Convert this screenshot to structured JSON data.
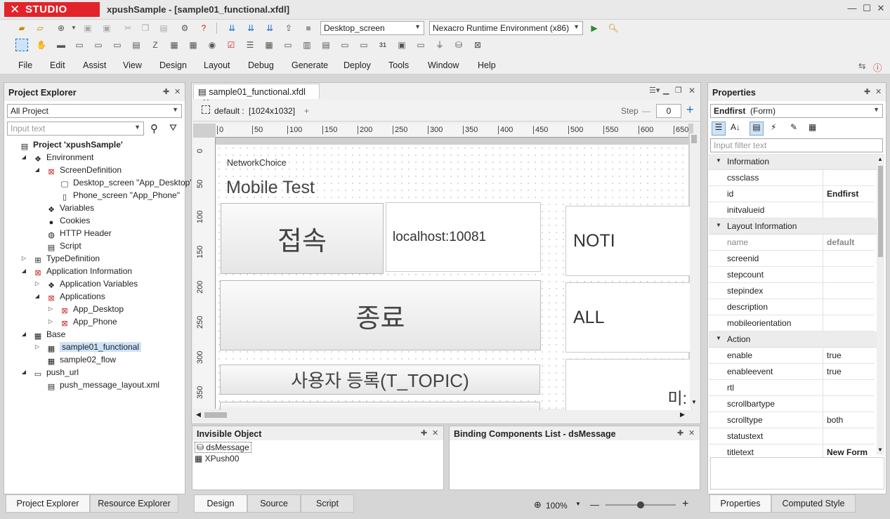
{
  "app": {
    "brand": "STUDIO",
    "window_title": "xpushSample - [sample01_functional.xfdl]"
  },
  "toolbar": {
    "screen_combo": "Desktop_screen",
    "runtime_combo": "Nexacro Runtime Environment (x86)"
  },
  "menu": [
    "File",
    "Edit",
    "Assist",
    "View",
    "Design",
    "Layout",
    "Debug",
    "Generate",
    "Deploy",
    "Tools",
    "Window",
    "Help"
  ],
  "project_explorer": {
    "title": "Project Explorer",
    "filter_combo": "All Project",
    "search_placeholder": "Input text",
    "tree": [
      {
        "label": "Project 'xpushSample'",
        "level": 0,
        "bold": true,
        "exp": "",
        "icon": "project-icon"
      },
      {
        "label": "Environment",
        "level": 1,
        "exp": "▲",
        "icon": "environment-icon"
      },
      {
        "label": "ScreenDefinition",
        "level": 2,
        "exp": "▲",
        "icon": "screen-definition-icon"
      },
      {
        "label": "Desktop_screen \"App_Desktop\"",
        "level": 3,
        "exp": "",
        "icon": "monitor-icon"
      },
      {
        "label": "Phone_screen \"App_Phone\"",
        "level": 3,
        "exp": "",
        "icon": "phone-icon"
      },
      {
        "label": "Variables",
        "level": 2,
        "exp": "",
        "icon": "variables-icon"
      },
      {
        "label": "Cookies",
        "level": 2,
        "exp": "",
        "icon": "cookie-icon"
      },
      {
        "label": "HTTP Header",
        "level": 2,
        "exp": "",
        "icon": "globe-icon"
      },
      {
        "label": "Script",
        "level": 2,
        "exp": "",
        "icon": "script-icon"
      },
      {
        "label": "TypeDefinition",
        "level": 1,
        "exp": "▷",
        "icon": "typedefinition-icon"
      },
      {
        "label": "Application Information",
        "level": 1,
        "exp": "▲",
        "icon": "app-info-icon"
      },
      {
        "label": "Application Variables",
        "level": 2,
        "exp": "▷",
        "icon": "app-variables-icon"
      },
      {
        "label": "Applications",
        "level": 2,
        "exp": "▲",
        "icon": "applications-icon"
      },
      {
        "label": "App_Desktop",
        "level": 3,
        "exp": "▷",
        "icon": "application-icon"
      },
      {
        "label": "App_Phone",
        "level": 3,
        "exp": "▷",
        "icon": "application-icon"
      },
      {
        "label": "Base",
        "level": 1,
        "exp": "▲",
        "icon": "base-icon"
      },
      {
        "label": "sample01_functional",
        "level": 2,
        "exp": "▷",
        "icon": "form-icon",
        "selected": true
      },
      {
        "label": "sample02_flow",
        "level": 2,
        "exp": "",
        "icon": "form-icon"
      },
      {
        "label": "push_url",
        "level": 1,
        "exp": "▲",
        "icon": "folder-icon"
      },
      {
        "label": "push_message_layout.xml",
        "level": 2,
        "exp": "",
        "icon": "xml-file-icon"
      }
    ],
    "tabs": [
      "Project Explorer",
      "Resource Explorer"
    ]
  },
  "editor": {
    "tab_label": "sample01_functional.xfdl",
    "layout_label": "default :",
    "layout_size": "[1024x1032]",
    "add_label": "+",
    "step_label": "Step",
    "step_value": "0",
    "ruler_top": [
      "0",
      "50",
      "100",
      "150",
      "200",
      "250",
      "300",
      "350",
      "400",
      "450",
      "500",
      "550",
      "600",
      "650"
    ],
    "ruler_left": [
      "0",
      "50",
      "100",
      "150",
      "200",
      "250",
      "300",
      "350"
    ],
    "form": {
      "network_label": "NetworkChoice",
      "title": "Mobile Test",
      "btn_connect": "접속",
      "host": "localhost:10081",
      "btn_noti": "NOTI",
      "btn_exit": "종료",
      "btn_all": "ALL",
      "btn_register": "사용자 등록(T_TOPIC)",
      "partial_text": "미:"
    },
    "bottom_tabs": [
      "Design",
      "Source",
      "Script"
    ],
    "zoom": "100%"
  },
  "invisible_object": {
    "title": "Invisible Object",
    "items": [
      "dsMessage",
      "XPush00"
    ]
  },
  "binding": {
    "title": "Binding Components List - dsMessage"
  },
  "properties": {
    "title": "Properties",
    "object_name": "Endfirst",
    "object_type": "(Form)",
    "filter_placeholder": "Input filter text",
    "categories": [
      {
        "name": "Information",
        "rows": [
          {
            "name": "cssclass",
            "value": ""
          },
          {
            "name": "id",
            "value": "Endfirst",
            "bold": true
          },
          {
            "name": "initvalueid",
            "value": ""
          }
        ]
      },
      {
        "name": "Layout Information",
        "rows": [
          {
            "name": "name",
            "value": "default",
            "gray": true
          },
          {
            "name": "screenid",
            "value": ""
          },
          {
            "name": "stepcount",
            "value": ""
          },
          {
            "name": "stepindex",
            "value": ""
          },
          {
            "name": "description",
            "value": ""
          },
          {
            "name": "mobileorientation",
            "value": ""
          }
        ]
      },
      {
        "name": "Action",
        "rows": [
          {
            "name": "enable",
            "value": "true"
          },
          {
            "name": "enableevent",
            "value": "true"
          },
          {
            "name": "rtl",
            "value": ""
          },
          {
            "name": "scrollbartype",
            "value": ""
          },
          {
            "name": "scrolltype",
            "value": "both"
          },
          {
            "name": "statustext",
            "value": ""
          },
          {
            "name": "titletext",
            "value": "New Form",
            "bold": true
          }
        ]
      }
    ],
    "tabs": [
      "Properties",
      "Computed Style"
    ]
  }
}
